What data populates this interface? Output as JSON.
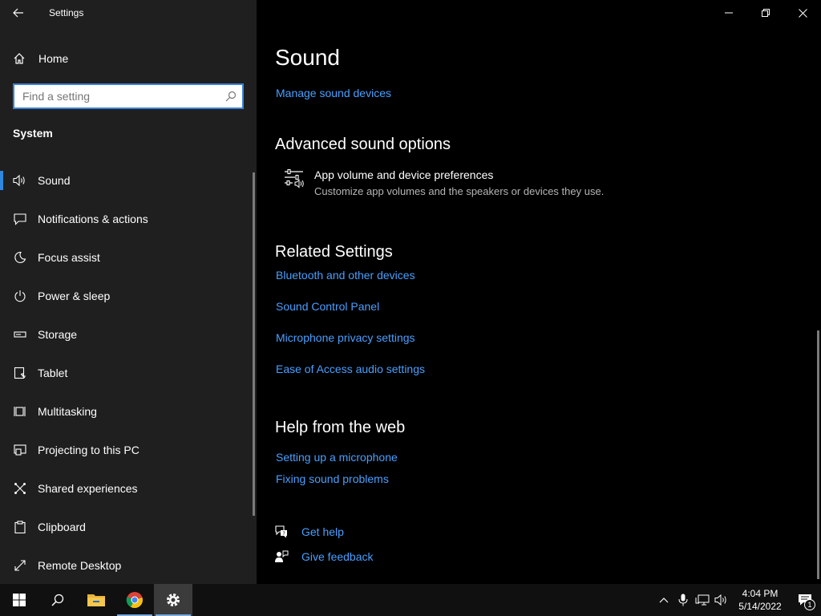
{
  "window": {
    "title": "Settings"
  },
  "sidebar": {
    "home_label": "Home",
    "search_placeholder": "Find a setting",
    "section_title": "System",
    "items": [
      {
        "label": "Sound",
        "icon": "speaker-icon",
        "active": true
      },
      {
        "label": "Notifications & actions",
        "icon": "notification-icon"
      },
      {
        "label": "Focus assist",
        "icon": "moon-icon"
      },
      {
        "label": "Power & sleep",
        "icon": "power-icon"
      },
      {
        "label": "Storage",
        "icon": "storage-icon"
      },
      {
        "label": "Tablet",
        "icon": "tablet-icon"
      },
      {
        "label": "Multitasking",
        "icon": "multitasking-icon"
      },
      {
        "label": "Projecting to this PC",
        "icon": "projecting-icon"
      },
      {
        "label": "Shared experiences",
        "icon": "shared-icon"
      },
      {
        "label": "Clipboard",
        "icon": "clipboard-icon"
      },
      {
        "label": "Remote Desktop",
        "icon": "remote-desktop-icon"
      }
    ]
  },
  "content": {
    "title": "Sound",
    "manage_link": "Manage sound devices",
    "advanced_heading": "Advanced sound options",
    "app_volume_title": "App volume and device preferences",
    "app_volume_desc": "Customize app volumes and the speakers or devices they use.",
    "related_heading": "Related Settings",
    "related_links": [
      "Bluetooth and other devices",
      "Sound Control Panel",
      "Microphone privacy settings",
      "Ease of Access audio settings"
    ],
    "help_heading": "Help from the web",
    "help_links": [
      "Setting up a microphone",
      "Fixing sound problems"
    ],
    "get_help": "Get help",
    "give_feedback": "Give feedback"
  },
  "taskbar": {
    "time": "4:04 PM",
    "date": "5/14/2022",
    "notification_count": "1"
  },
  "colors": {
    "accent": "#2e86de",
    "link": "#4a9fff",
    "sidebar_bg": "#1f1f1f",
    "content_bg": "#000000"
  }
}
